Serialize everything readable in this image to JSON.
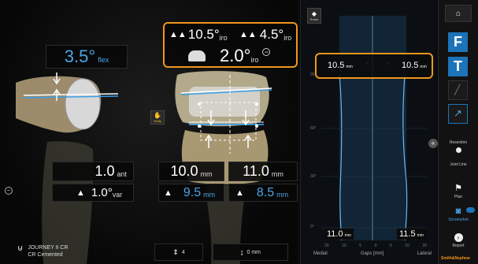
{
  "flex": {
    "value": "3.5°",
    "unit": "flex"
  },
  "top_panel": {
    "left_value": "10.5°",
    "left_unit": "iro",
    "right_value": "4.5°",
    "right_unit": "iro",
    "center_value": "2.0°",
    "center_unit": "iro"
  },
  "verify_label": "Verify",
  "left_measures": {
    "ant_value": "1.0",
    "ant_unit": "ant",
    "var_value": "1.0°",
    "var_unit": "var"
  },
  "gap_measures": {
    "top_left_value": "10.0",
    "top_left_unit": "mm",
    "top_right_value": "11.0",
    "top_right_unit": "mm",
    "bottom_left_value": "9.5",
    "bottom_left_unit": "mm",
    "bottom_right_value": "8.5",
    "bottom_right_unit": "mm"
  },
  "implant": {
    "line1": "JOURNEY II CR",
    "line2": "CR Cemented"
  },
  "bottom_controls": {
    "count_label": "4",
    "offset_label": "0 mm"
  },
  "gap_chart": {
    "erase_label": "Erase",
    "top_left_value": "10.5",
    "top_left_unit": "mm",
    "top_right_value": "10.5",
    "top_right_unit": "mm",
    "bottom_left_value": "11.0",
    "bottom_left_unit": "mm",
    "bottom_right_value": "11.5",
    "bottom_right_unit": "mm",
    "angle_labels": [
      "90°",
      "60°",
      "30°",
      "0°"
    ],
    "xticks": [
      "20",
      "10",
      "5",
      "0",
      "5",
      "10",
      "20"
    ],
    "xlabel_left": "Medial",
    "xlabel_center": "Gaps [mm]",
    "xlabel_right": "Lateral"
  },
  "sidebar": {
    "tool_f": "F",
    "tool_t": "T",
    "resection_label": "Resection",
    "jointline_label": "Joint Line",
    "plan_label": "Plan",
    "screenshot_label": "Screenshot",
    "report_label": "Report",
    "brand": "Smith&Nephew"
  },
  "colors": {
    "accent_orange": "#f0961c",
    "accent_blue": "#4ba4e6",
    "button_blue": "#1d73b8"
  }
}
